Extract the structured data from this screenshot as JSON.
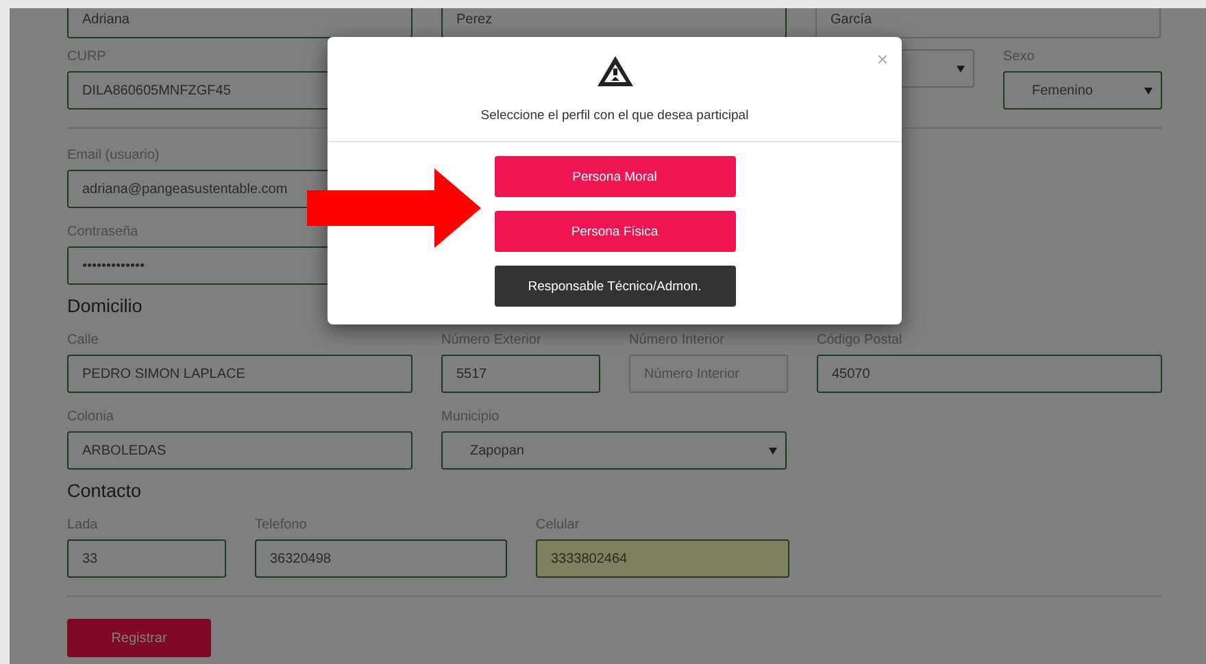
{
  "form": {
    "rows": [
      {
        "kind": "fields",
        "fields": [
          {
            "kind": "input",
            "value": "Adriana",
            "validated": true
          },
          {
            "kind": "input",
            "value": "Perez",
            "validated": true
          },
          {
            "kind": "input",
            "value": "García",
            "validated": false
          }
        ]
      },
      {
        "kind": "fields",
        "fields": [
          {
            "kind": "input",
            "label": "CURP",
            "value": "DILA860605MNFZGF45",
            "validated": true
          },
          {
            "kind": "select",
            "validated": false
          },
          {
            "kind": "select",
            "label": "Sexo",
            "value": "Femenino",
            "validated": true
          }
        ]
      },
      {
        "kind": "divider"
      },
      {
        "kind": "fields",
        "fields": [
          {
            "kind": "input",
            "label": "Email (usuario)",
            "value": "adriana@pangeasustentable.com",
            "validated": true
          }
        ]
      },
      {
        "kind": "fields",
        "fields": [
          {
            "kind": "input",
            "label": "Contraseña",
            "value": "•••••••••••••",
            "validated": true
          }
        ]
      },
      {
        "kind": "heading",
        "text": "Domicilio"
      },
      {
        "kind": "fields",
        "fields": [
          {
            "kind": "input",
            "label": "Calle",
            "value": "PEDRO SIMON LAPLACE",
            "validated": true
          },
          {
            "kind": "input",
            "label": "Número Exterior",
            "value": "5517",
            "validated": true
          },
          {
            "kind": "input",
            "label": "Número Interior",
            "placeholder": "Número Interior",
            "validated": false
          },
          {
            "kind": "input",
            "label": "Código Postal",
            "value": "45070",
            "validated": true
          }
        ]
      },
      {
        "kind": "fields",
        "fields": [
          {
            "kind": "input",
            "label": "Colonia",
            "value": "ARBOLEDAS",
            "validated": true
          },
          {
            "kind": "select",
            "label": "Municipio",
            "value": "Zapopan",
            "validated": true
          }
        ]
      },
      {
        "kind": "heading",
        "text": "Contacto"
      },
      {
        "kind": "fields",
        "fields": [
          {
            "kind": "input",
            "label": "Lada",
            "value": "33",
            "validated": true
          },
          {
            "kind": "input",
            "label": "Telefono",
            "value": "36320498",
            "validated": true
          },
          {
            "kind": "input",
            "label": "Celular",
            "value": "3333802464",
            "validated": true,
            "autofilled": true
          }
        ]
      },
      {
        "kind": "divider"
      },
      {
        "kind": "button",
        "text": "Registrar"
      }
    ]
  },
  "modal": {
    "message": "Seleccione el perfil con el que desea participal",
    "close": "×",
    "options": [
      {
        "label": "Persona Moral",
        "kind": "primary"
      },
      {
        "label": "Persona Física",
        "kind": "primary"
      },
      {
        "label": "Responsable Técnico/Admon.",
        "kind": "dark"
      }
    ]
  }
}
